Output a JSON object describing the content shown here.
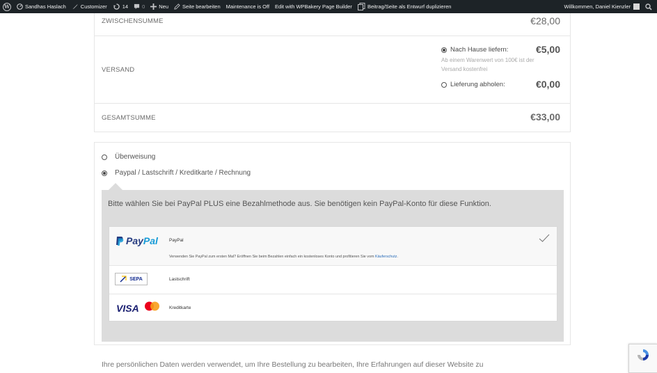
{
  "admin_bar": {
    "site_name": "Sandhas Haslach",
    "customizer": "Customizer",
    "updates_count": "14",
    "comments_count": "0",
    "new_label": "Neu",
    "edit_page": "Seite bearbeiten",
    "maintenance": "Maintenance is Off",
    "wpbakery": "Edit with WPBakery Page Builder",
    "duplicate": "Beitrag/Seite als Entwurf duplizieren",
    "welcome": "Willkommen, Daniel Kienzler"
  },
  "totals": {
    "subtotal_label": "ZWISCHENSUMME",
    "subtotal_value": "€28,00",
    "shipping_label": "VERSAND",
    "shipping_options": [
      {
        "label": "Nach Hause liefern:",
        "amount": "€5,00",
        "selected": true
      },
      {
        "label": "Lieferung abholen:",
        "amount": "€0,00",
        "selected": false
      }
    ],
    "shipping_note": "Ab einem Warenwert von 100€ ist der Versand kostenfrei",
    "total_label": "GESAMTSUMME",
    "total_value": "€33,00"
  },
  "payment": {
    "methods": [
      {
        "label": "Überweisung",
        "selected": false
      },
      {
        "label": "Paypal / Lastschrift / Kreditkarte / Rechnung",
        "selected": true
      }
    ],
    "intro": "Bitte wählen Sie bei PayPal PLUS eine Bezahlmethode aus. Sie benötigen kein PayPal-Konto für diese Funktion.",
    "paypal_logo": [
      "Pay",
      "Pal"
    ],
    "paypal_name": "PayPal",
    "paypal_desc": "Verwenden Sie PayPal zum ersten Mal? Eröffnen Sie beim Bezahlen einfach ein kostenloses Konto und profitieren Sie vom",
    "paypal_link": "Käuferschutz",
    "sepa_logo": "SEPA",
    "sepa_name": "Lastschrift",
    "visa_logo": "VISA",
    "card_name": "Kreditkarte"
  },
  "privacy_text": "Ihre persönlichen Daten werden verwendet, um Ihre Bestellung zu bearbeiten, Ihre Erfahrungen auf dieser Website zu",
  "colors": {
    "admin_bar_bg": "#1d2327",
    "panel_bg": "#dcdcdc",
    "paypal_dark": "#253b80",
    "paypal_light": "#179bd7",
    "link": "#2a6cb8",
    "visa": "#1a1f71",
    "mastercard_red": "#eb001b",
    "mastercard_orange": "#f79e1b"
  }
}
